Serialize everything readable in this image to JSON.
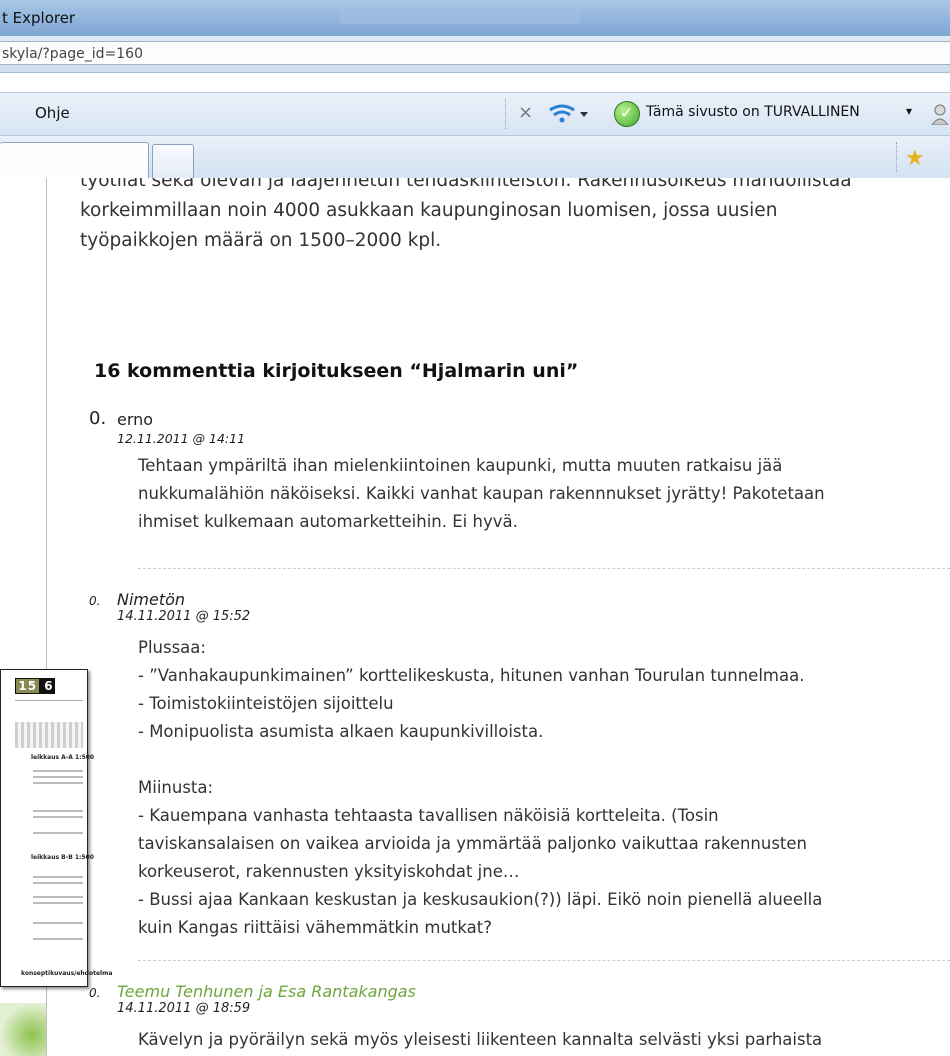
{
  "window": {
    "title": "t Explorer",
    "address": "skyla/?page_id=160"
  },
  "menubar": {
    "help_label": "Ohje",
    "security_text": "Tämä sivusto on TURVALLINEN",
    "security_caret": "▾",
    "close_glyph": "×"
  },
  "colors": {
    "accent_green": "#5cae2a",
    "link_author": "#6ea63c"
  },
  "intro": {
    "lines": [
      "työtilat sekä olevan ja laajennetun tehdaskiinteistön. Rakennusoikeus mahdollistaa",
      "korkeimmillaan noin 4000 asukkaan kaupunginosan luomisen, jossa uusien",
      "työpaikkojen määrä on 1500–2000 kpl."
    ]
  },
  "comments_heading": "16 kommenttia kirjoitukseen “Hjalmarin uni”",
  "comments": [
    {
      "number": "0.",
      "author": "erno",
      "date": "12.11.2011 @ 14:11",
      "body": [
        "Tehtaan ympäriltä ihan mielenkiintoinen kaupunki, mutta muuten ratkaisu jää",
        "nukkumalähiön näköiseksi. Kaikki vanhat kaupan rakennnukset jyrätty! Pakotetaan",
        "ihmiset kulkemaan automarketteihin. Ei hyvä."
      ]
    },
    {
      "number": "0.",
      "author": "Nimetön",
      "date": "14.11.2011 @ 15:52",
      "body": [
        "Plussaa:",
        "- ”Vanhakaupunkimainen” korttelikeskusta, hitunen vanhan Tourulan tunnelmaa.",
        "- Toimistokiinteistöjen sijoittelu",
        "- Monipuolista asumista alkaen kaupunkivilloista.",
        "",
        "Miinusta:",
        "- Kauempana vanhasta tehtaasta tavallisen näköisiä kortteleita. (Tosin",
        "taviskansalaisen on vaikea arvioida ja ymmärtää paljonko vaikuttaa rakennusten",
        "korkeuserot, rakennusten yksityiskohdat jne…",
        "- Bussi ajaa Kankaan keskustan ja keskusaukion(?)) läpi. Eikö noin pienellä alueella",
        "kuin Kangas riittäisi vähemmätkin mutkat?"
      ]
    },
    {
      "number": "0.",
      "author": "Teemu Tenhunen ja Esa Rantakangas",
      "date": "14.11.2011 @ 18:59",
      "body": [
        "Kävelyn ja pyöräilyn sekä myös yleisesti liikenteen kannalta selvästi yksi parhaista"
      ]
    }
  ],
  "overlay_doc": {
    "page_number_a": "15",
    "page_number_b": "6",
    "labels": [
      "leikkaus A-A  1:500",
      "leikkaus B-B  1:500",
      "konseptikuvaus/ehdotelma"
    ]
  }
}
